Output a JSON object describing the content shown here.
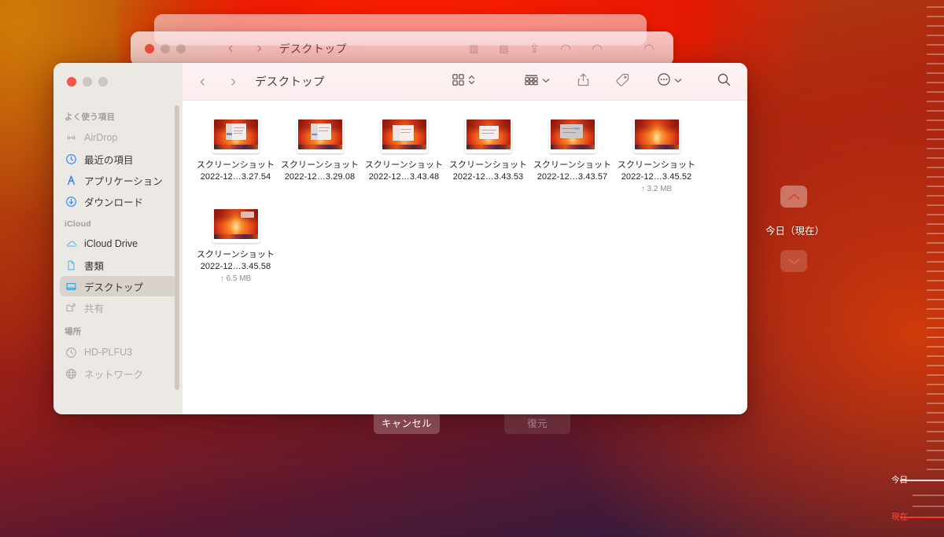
{
  "window": {
    "title": "デスクトップ",
    "nav_back": "‹",
    "nav_forward": "›",
    "traffic_lights": [
      "close",
      "minimize",
      "zoom"
    ]
  },
  "toolbar": {
    "items": [
      {
        "name": "view-grid",
        "icon": "grid-icon",
        "chevron": "updown"
      },
      {
        "name": "group-by",
        "icon": "group-list-icon",
        "chevron": "down"
      },
      {
        "name": "share",
        "icon": "share-icon",
        "chevron": ""
      },
      {
        "name": "tags",
        "icon": "tag-icon",
        "chevron": ""
      },
      {
        "name": "more-options",
        "icon": "ellipsis-circle-icon",
        "chevron": "down"
      },
      {
        "name": "search",
        "icon": "search-icon",
        "chevron": ""
      }
    ]
  },
  "sidebar": {
    "groups": [
      {
        "label": "よく使う項目",
        "items": [
          {
            "label": "AirDrop",
            "icon": "airdrop-icon",
            "state": "dim"
          },
          {
            "label": "最近の項目",
            "icon": "clock-icon",
            "state": "normal"
          },
          {
            "label": "アプリケーション",
            "icon": "applications-icon",
            "state": "normal"
          },
          {
            "label": "ダウンロード",
            "icon": "download-icon",
            "state": "normal"
          }
        ]
      },
      {
        "label": "iCloud",
        "items": [
          {
            "label": "iCloud Drive",
            "icon": "cloud-icon",
            "state": "normal"
          },
          {
            "label": "書類",
            "icon": "document-icon",
            "state": "normal"
          },
          {
            "label": "デスクトップ",
            "icon": "desktop-icon",
            "state": "selected"
          },
          {
            "label": "共有",
            "icon": "shared-folder-icon",
            "state": "dim"
          }
        ]
      },
      {
        "label": "場所",
        "items": [
          {
            "label": "HD-PLFU3",
            "icon": "timemachine-disk-icon",
            "state": "dim"
          },
          {
            "label": "ネットワーク",
            "icon": "network-globe-icon",
            "state": "dim"
          }
        ]
      }
    ]
  },
  "files": {
    "row1": [
      {
        "name_line1": "スクリーンショット",
        "name_line2": "2022-12…3.27.54",
        "size": ""
      },
      {
        "name_line1": "スクリーンショット",
        "name_line2": "2022-12…3.29.08",
        "size": ""
      },
      {
        "name_line1": "スクリーンショット",
        "name_line2": "2022-12…3.43.48",
        "size": ""
      },
      {
        "name_line1": "スクリーンショット",
        "name_line2": "2022-12…3.43.53",
        "size": ""
      },
      {
        "name_line1": "スクリーンショット",
        "name_line2": "2022-12…3.43.57",
        "size": ""
      },
      {
        "name_line1": "スクリーンショット",
        "name_line2": "2022-12…3.45.52",
        "size": "↑ 3.2 MB"
      }
    ],
    "row2": [
      {
        "name_line1": "スクリーンショット",
        "name_line2": "2022-12…3.45.58",
        "size": "↑ 6.5 MB"
      }
    ]
  },
  "timemachine": {
    "current_date": "今日（現在）",
    "up_arrow": "⌃",
    "down_arrow": "⌄",
    "cancel_label": "キャンセル",
    "restore_label": "復元",
    "timeline": {
      "today_label": "今日",
      "now_label": "現在"
    }
  },
  "colors": {
    "accent_blue": "#2d7ff9",
    "close_red": "#f8544a",
    "now_red": "#ff3b28",
    "selected_bg": "#d9d2cd",
    "toolbar_bg": "#fbedee",
    "sidebar_bg": "#ece8e4"
  }
}
